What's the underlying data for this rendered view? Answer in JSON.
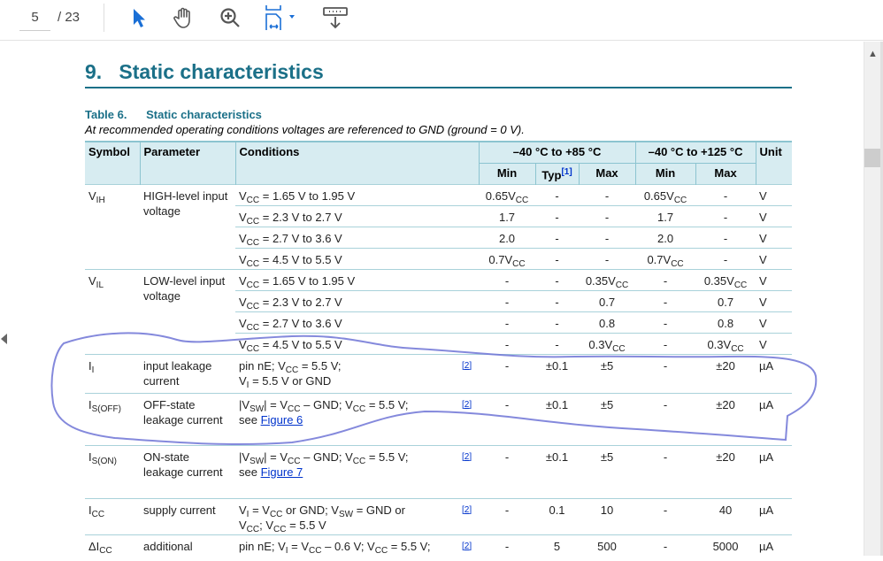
{
  "toolbar": {
    "page_current": "5",
    "page_total": "/ 23",
    "tools": [
      "select-cursor-icon",
      "hand-icon",
      "zoom-in-icon",
      "fit-page-icon",
      "download-icon"
    ],
    "accent": "#1a6fd6"
  },
  "document": {
    "heading": "9.   Static characteristics",
    "table_caption": "Table 6.      Static characteristics",
    "table_subtitle": "At recommended operating conditions voltages are referenced to GND (ground = 0 V).",
    "colors": {
      "heading": "#1b7088",
      "header_bg": "#d7ecf1",
      "annotation": "#6f74d6",
      "link": "#0033cc"
    },
    "header": {
      "symbol": "Symbol",
      "parameter": "Parameter",
      "conditions": "Conditions",
      "range1": "–40 °C to +85 °C",
      "range2": "–40 °C to +125 °C",
      "unit": "Unit",
      "min": "Min",
      "typ": "Typ",
      "typ_note": "[1]",
      "max": "Max",
      "min2": "Min",
      "max2": "Max"
    },
    "groups": [
      {
        "symbol": [
          "V",
          {
            "s": "IH"
          }
        ],
        "parameter": "HIGH-level input voltage",
        "rows": [
          {
            "cond": [
              "V",
              {
                "s": "CC"
              },
              " = 1.65 V to 1.95 V"
            ],
            "note": "",
            "v": [
              [
                "0.65V",
                {
                  "s": "CC"
                }
              ],
              "-",
              "-",
              [
                "0.65V",
                {
                  "s": "CC"
                }
              ],
              "-"
            ],
            "unit": "V"
          },
          {
            "cond": [
              "V",
              {
                "s": "CC"
              },
              " = 2.3 V to 2.7 V"
            ],
            "note": "",
            "v": [
              "1.7",
              "-",
              "-",
              "1.7",
              "-"
            ],
            "unit": "V"
          },
          {
            "cond": [
              "V",
              {
                "s": "CC"
              },
              " = 2.7 V to 3.6 V"
            ],
            "note": "",
            "v": [
              "2.0",
              "-",
              "-",
              "2.0",
              "-"
            ],
            "unit": "V"
          },
          {
            "cond": [
              "V",
              {
                "s": "CC"
              },
              " = 4.5 V to 5.5 V"
            ],
            "note": "",
            "v": [
              [
                "0.7V",
                {
                  "s": "CC"
                }
              ],
              "-",
              "-",
              [
                "0.7V",
                {
                  "s": "CC"
                }
              ],
              "-"
            ],
            "unit": "V"
          }
        ]
      },
      {
        "symbol": [
          "V",
          {
            "s": "IL"
          }
        ],
        "parameter": "LOW-level input voltage",
        "rows": [
          {
            "cond": [
              "V",
              {
                "s": "CC"
              },
              " = 1.65 V to 1.95 V"
            ],
            "note": "",
            "v": [
              "-",
              "-",
              [
                "0.35V",
                {
                  "s": "CC"
                }
              ],
              "-",
              [
                "0.35V",
                {
                  "s": "CC"
                }
              ]
            ],
            "unit": "V"
          },
          {
            "cond": [
              "V",
              {
                "s": "CC"
              },
              " = 2.3 V to 2.7 V"
            ],
            "note": "",
            "v": [
              "-",
              "-",
              "0.7",
              "-",
              "0.7"
            ],
            "unit": "V"
          },
          {
            "cond": [
              "V",
              {
                "s": "CC"
              },
              " = 2.7 V to 3.6 V"
            ],
            "note": "",
            "v": [
              "-",
              "-",
              "0.8",
              "-",
              "0.8"
            ],
            "unit": "V"
          },
          {
            "cond": [
              "V",
              {
                "s": "CC"
              },
              " = 4.5 V to 5.5 V"
            ],
            "note": "",
            "v": [
              "-",
              "-",
              [
                "0.3V",
                {
                  "s": "CC"
                }
              ],
              "-",
              [
                "0.3V",
                {
                  "s": "CC"
                }
              ]
            ],
            "unit": "V"
          }
        ]
      },
      {
        "symbol": [
          "I",
          {
            "s": "I"
          }
        ],
        "parameter": "input leakage current",
        "rows": [
          {
            "cond": [
              "pin nE; V",
              {
                "s": "CC"
              },
              " = 5.5 V;",
              {
                "br": 1
              },
              "V",
              {
                "s": "I"
              },
              " = 5.5 V or GND"
            ],
            "note": "[2]",
            "v": [
              "-",
              "±0.1",
              "±5",
              "-",
              "±20"
            ],
            "unit": "µA"
          }
        ]
      },
      {
        "symbol": [
          "I",
          {
            "s": "S(OFF)"
          }
        ],
        "parameter": "OFF-state leakage current",
        "rows": [
          {
            "cond": [
              "|V",
              {
                "s": "SW"
              },
              "| = V",
              {
                "s": "CC"
              },
              " – GND; V",
              {
                "s": "CC"
              },
              " = 5.5 V;",
              {
                "br": 1
              },
              "see ",
              {
                "link": "Figure 6"
              }
            ],
            "note": "[2]",
            "v": [
              "-",
              "±0.1",
              "±5",
              "-",
              "±20"
            ],
            "unit": "µA"
          }
        ]
      },
      {
        "symbol": [
          "I",
          {
            "s": "S(ON)"
          }
        ],
        "parameter": "ON-state leakage current",
        "rows": [
          {
            "cond": [
              "|V",
              {
                "s": "SW"
              },
              "| = V",
              {
                "s": "CC"
              },
              " – GND; V",
              {
                "s": "CC"
              },
              " = 5.5 V;",
              {
                "br": 1
              },
              "see ",
              {
                "link": "Figure 7"
              }
            ],
            "note": "[2]",
            "v": [
              "-",
              "±0.1",
              "±5",
              "-",
              "±20"
            ],
            "unit": "µA"
          }
        ]
      },
      {
        "symbol": [
          "I",
          {
            "s": "CC"
          }
        ],
        "parameter": "supply current",
        "rows": [
          {
            "cond": [
              "V",
              {
                "s": "I"
              },
              " = V",
              {
                "s": "CC"
              },
              " or GND; V",
              {
                "s": "SW"
              },
              " = GND or",
              {
                "br": 1
              },
              "V",
              {
                "s": "CC"
              },
              "; V",
              {
                "s": "CC"
              },
              " = 5.5 V"
            ],
            "note": "[2]",
            "v": [
              "-",
              "0.1",
              "10",
              "-",
              "40"
            ],
            "unit": "µA"
          }
        ]
      },
      {
        "symbol": [
          "ΔI",
          {
            "s": "CC"
          }
        ],
        "parameter": "additional",
        "rows": [
          {
            "cond": [
              "pin nE; V",
              {
                "s": "I"
              },
              " = V",
              {
                "s": "CC"
              },
              " – 0.6 V; V",
              {
                "s": "CC"
              },
              " = 5.5 V;"
            ],
            "note": "[2]",
            "v": [
              "-",
              "5",
              "500",
              "-",
              "5000"
            ],
            "unit": "µA"
          }
        ]
      }
    ]
  }
}
